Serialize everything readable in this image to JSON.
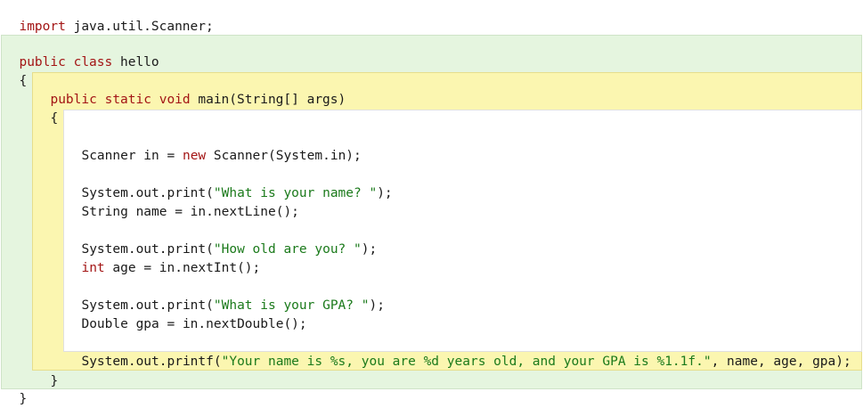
{
  "code": {
    "import_kw": "import",
    "import_rest": " java.util.Scanner;",
    "class_kw1": "public",
    "class_kw2": "class",
    "class_name": " hello",
    "open_brace_class": "{",
    "method_kw1": "public",
    "method_kw2": "static",
    "method_kw3": "void",
    "method_rest": " main(String[] args)",
    "open_brace_method": "{",
    "scanner_a": "Scanner in = ",
    "scanner_new": "new",
    "scanner_b": " Scanner(System.in);",
    "print1_a": "System.out.print(",
    "print1_str": "\"What is your name? \"",
    "print1_b": ");",
    "name_line": "String name = in.nextLine();",
    "print2_a": "System.out.print(",
    "print2_str": "\"How old are you? \"",
    "print2_b": ");",
    "age_kw": "int",
    "age_rest": " age = in.nextInt();",
    "print3_a": "System.out.print(",
    "print3_str": "\"What is your GPA? \"",
    "print3_b": ");",
    "gpa_line": "Double gpa = in.nextDouble();",
    "printf_a": "System.out.printf(",
    "printf_str": "\"Your name is %s, you are %d years old, and your GPA is %1.1f.\"",
    "printf_b": ", name, age, gpa);",
    "close_brace_method": "}",
    "close_brace_class": "}"
  },
  "colors": {
    "keyword": "#a31515",
    "string": "#1b7a1b",
    "class_block_bg": "#e5f5df",
    "method_block_bg": "#fbf6b0"
  }
}
